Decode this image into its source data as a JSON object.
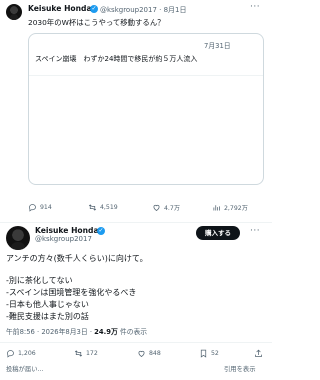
{
  "post1": {
    "name": "Keisuke Honda",
    "handle_time": "@kskgroup2017 · 8月1日",
    "text": "2030年のW杯はこうやって移動するん？",
    "quote": {
      "date": "7月31日",
      "text": "スペイン崩壊　わずか24時間で移民が約５万人流入"
    },
    "actions": {
      "replies": "914",
      "reposts": "4,519",
      "likes": "4.7万",
      "views": "2,792万"
    }
  },
  "post2": {
    "name": "Keisuke Honda",
    "handle": "@kskgroup2017",
    "subscribe_label": "購入する",
    "lines": [
      "アンチの方々(数千人くらい)に向けて。",
      "-別に茶化してない",
      "-スペインは国境管理を強化やるべき",
      "-日本も他人事じゃない",
      "-難民支援はまた別の話"
    ],
    "meta_time": "午前8:56 · 2026年8月3日 · ",
    "meta_views_value": "24.9万",
    "meta_views_label": " 件の表示",
    "actions": {
      "replies": "1,206",
      "reposts": "172",
      "likes": "848",
      "bookmarks": "52"
    },
    "reply_prompt": "投稿が届い...",
    "quote_prompt": "引用を表示"
  },
  "icons": {
    "verified": "verified-badge-icon",
    "more": "more-icon",
    "reply": "reply-icon",
    "repost": "repost-icon",
    "like": "like-icon",
    "views": "views-icon",
    "bookmark": "bookmark-icon",
    "share": "share-icon"
  },
  "colors": {
    "accent": "#1d9bf0",
    "muted": "#536471",
    "text": "#0f1419"
  }
}
